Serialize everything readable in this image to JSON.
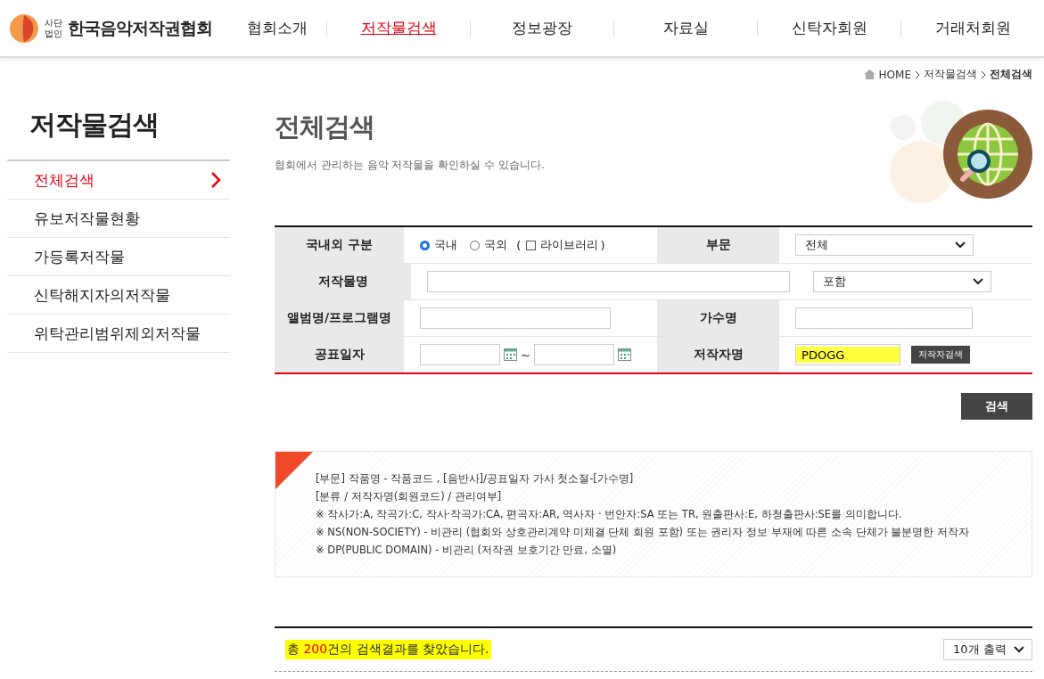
{
  "logo": {
    "small_top": "사단",
    "small_bottom": "법인",
    "name": "한국음악저작권협회"
  },
  "nav": [
    {
      "label": "협회소개",
      "selected": false
    },
    {
      "label": "저작물검색",
      "selected": true
    },
    {
      "label": "정보광장",
      "selected": false
    },
    {
      "label": "자료실",
      "selected": false
    },
    {
      "label": "신탁자회원",
      "selected": false
    },
    {
      "label": "거래처회원",
      "selected": false
    }
  ],
  "sidebar": {
    "title": "저작물검색",
    "items": [
      {
        "label": "전체검색",
        "selected": true
      },
      {
        "label": "유보저작물현황",
        "selected": false
      },
      {
        "label": "가등록저작물",
        "selected": false
      },
      {
        "label": "신탁해지자의저작물",
        "selected": false
      },
      {
        "label": "위탁관리범위제외저작물",
        "selected": false
      }
    ]
  },
  "breadcrumb": [
    "HOME",
    "저작물검색",
    "전체검색"
  ],
  "page": {
    "title": "전체검색",
    "subtitle": "협회에서 관리하는 음악 저작물을 확인하실 수 있습니다."
  },
  "form": {
    "region_label": "국내외 구분",
    "radios": [
      {
        "label": "국내",
        "selected": true
      },
      {
        "label": "국외",
        "selected": false
      }
    ],
    "library": {
      "open": "(",
      "label": "라이브러리",
      "close": ")",
      "checked": false
    },
    "section_label": "부문",
    "section_value": "전체",
    "title_label": "저작물명",
    "match_value": "포함",
    "album_label": "앨범명/프로그램명",
    "singer_label": "가수명",
    "date_label": "공표일자",
    "date_sep": "~",
    "author_label": "저작자명",
    "author_value": "PDOGG",
    "author_button": "저작자검색",
    "search_button": "검색"
  },
  "notes": [
    "[부문] 작품명 - 작품코드 , [음반사]/공표일자 가사 첫소절-[가수명]",
    "[분류 / 저작자명(회원코드) / 관리여부]",
    "※ 작사가:A, 작곡가:C, 작사·작곡가:CA, 편곡자:AR, 역사자 · 번안자:SA 또는 TR, 원출판사:E, 하청출판사:SE를 의미합니다.",
    "※ NS(NON-SOCIETY) - 비관리 (협회와 상호관리계약 미체결 단체 회원 포함) 또는 권리자 정보 부재에 따른 소속 단체가 불분명한 저작자",
    "※ DP(PUBLIC DOMAIN) - 비관리 (저작권 보호기간 만료, 소멸)"
  ],
  "result": {
    "prefix": "총 ",
    "count": "200",
    "suffix": "건의 검색결과를 찾았습니다.",
    "per_page": "10개 출력"
  }
}
